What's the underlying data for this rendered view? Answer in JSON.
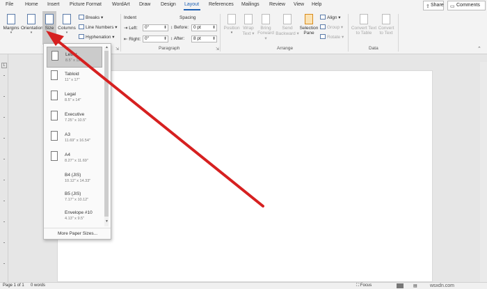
{
  "tabs": [
    "File",
    "Home",
    "Insert",
    "Picture Format",
    "WordArt",
    "Draw",
    "Design",
    "Layout",
    "References",
    "Mailings",
    "Review",
    "View",
    "Help"
  ],
  "active_tab": "Layout",
  "share_label": "Share",
  "comments_label": "Comments",
  "ribbon": {
    "margins": "Margins",
    "orientation": "Orientation",
    "size": "Size",
    "columns": "Columns",
    "breaks": "Breaks",
    "line_numbers": "Line Numbers",
    "hyphenation": "Hyphenation",
    "indent_header": "Indent",
    "left_label": "Left:",
    "left_value": "0\"",
    "right_label": "Right:",
    "right_value": "0\"",
    "spacing_header": "Spacing",
    "before_label": "Before:",
    "before_value": "0 pt",
    "after_label": "After:",
    "after_value": "8 pt",
    "paragraph_group": "Paragraph",
    "position": "Position",
    "wrap_text_1": "Wrap",
    "wrap_text_2": "Text",
    "bring_forward_1": "Bring",
    "bring_forward_2": "Forward",
    "send_backward_1": "Send",
    "send_backward_2": "Backward",
    "selection_pane_1": "Selection",
    "selection_pane_2": "Pane",
    "align": "Align",
    "group": "Group",
    "rotate": "Rotate",
    "arrange_group": "Arrange",
    "convert_to_table_1": "Convert Text",
    "convert_to_table_2": "to Table",
    "convert_to_text_1": "Convert",
    "convert_to_text_2": "to Text",
    "data_group": "Data"
  },
  "paper_sizes": [
    {
      "name": "Letter",
      "dims": "8.5\" x 11\""
    },
    {
      "name": "Tabloid",
      "dims": "11\" x 17\""
    },
    {
      "name": "Legal",
      "dims": "8.5\" x 14\""
    },
    {
      "name": "Executive",
      "dims": "7.25\" x 10.5\""
    },
    {
      "name": "A3",
      "dims": "11.69\" x 16.54\""
    },
    {
      "name": "A4",
      "dims": "8.27\" x 11.69\""
    },
    {
      "name": "B4 (JIS)",
      "dims": "10.12\" x 14.33\""
    },
    {
      "name": "B5 (JIS)",
      "dims": "7.17\" x 10.12\""
    },
    {
      "name": "Envelope #10",
      "dims": "4.13\" x 9.5\""
    }
  ],
  "more_paper_sizes": "More Paper Sizes...",
  "status": {
    "page": "Page 1 of 1",
    "words": "0 words",
    "focus": "Focus",
    "watermark": "wsxdn.com"
  },
  "colors": {
    "accent": "#1d5fb3",
    "annotation_arrow": "#d62020"
  }
}
